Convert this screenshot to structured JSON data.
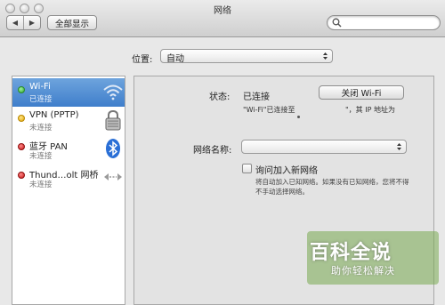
{
  "window": {
    "title": "网络",
    "nav_back": "◀",
    "nav_forward": "▶",
    "show_all_label": "全部显示",
    "search": {
      "placeholder": "",
      "icon": "magnifier"
    }
  },
  "location": {
    "label": "位置:",
    "value": "自动"
  },
  "services": [
    {
      "name": "Wi-Fi",
      "status": "已连接",
      "status_color": "#3fbf3f",
      "icon": "wifi-icon",
      "selected": true
    },
    {
      "name": "VPN (PPTP)",
      "status": "未连接",
      "status_color": "#f2b400",
      "icon": "lock-icon",
      "selected": false
    },
    {
      "name": "蓝牙 PAN",
      "status": "未连接",
      "status_color": "#d42222",
      "icon": "bluetooth-icon",
      "selected": false
    },
    {
      "name": "Thund…olt 网桥",
      "status": "未连接",
      "status_color": "#d42222",
      "icon": "thunderbolt-bridge-icon",
      "selected": false
    }
  ],
  "detail": {
    "status_label": "状态:",
    "status_value": "已连接",
    "wifi_off_button": "关闭 Wi-Fi",
    "connection_desc": "\"Wi-Fi\"已连接至",
    "ip_desc": "\"，其 IP 地址为",
    "network_name_label": "网络名称:",
    "network_name_value": "",
    "ask_join_label": "询问加入新网络",
    "ask_join_desc": "将自动加入已知网络。如果没有已知网络，您将不得不手动选择网络。"
  },
  "watermark": {
    "title": "百科全说",
    "subtitle": "助你轻松解决"
  },
  "colors": {
    "selection": "#4a86d0",
    "window_bg": "#e8e8e8"
  }
}
